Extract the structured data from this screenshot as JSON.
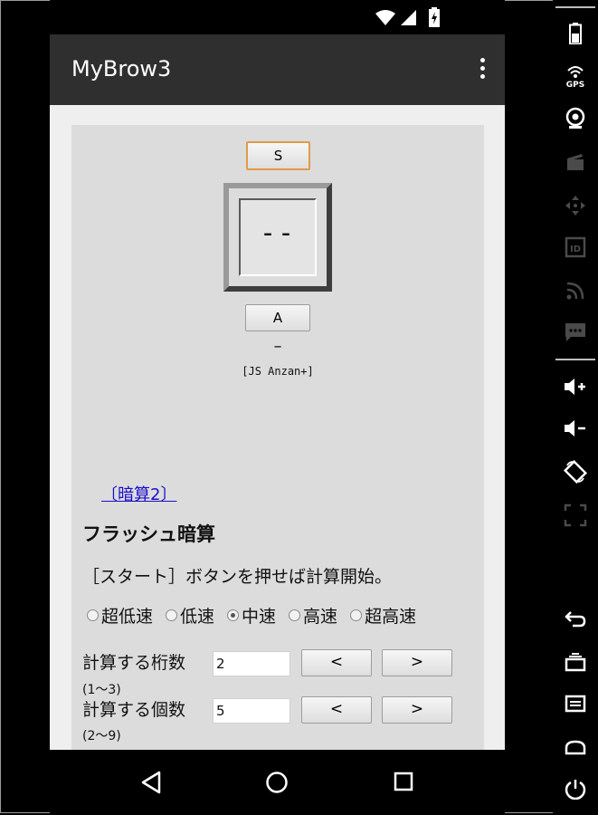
{
  "app": {
    "title": "MyBrow3"
  },
  "page": {
    "start_button": "S",
    "display_value": "--",
    "answer_button": "A",
    "dash": "–",
    "js_label": "[JS Anzan+]",
    "link_text": "〔暗算2〕",
    "heading": "フラッシュ暗算",
    "instruction": "［スタート］ボタンを押せば計算開始。",
    "speeds": [
      {
        "label": "超低速",
        "checked": false
      },
      {
        "label": "低速",
        "checked": false
      },
      {
        "label": "中速",
        "checked": true
      },
      {
        "label": "高速",
        "checked": false
      },
      {
        "label": "超高速",
        "checked": false
      }
    ],
    "digits": {
      "label": "計算する桁数",
      "range": "(1～3)",
      "value": "2",
      "dec": "<",
      "inc": ">"
    },
    "count": {
      "label": "計算する個数",
      "range": "(2～9)",
      "value": "5",
      "dec": "<",
      "inc": ">"
    }
  },
  "colors": {
    "app_bar": "#2f2f2f",
    "web_bg": "#dcdcdc",
    "link": "#1a0dcc",
    "focus_border": "#e19a4a"
  },
  "icons": {
    "status": [
      "wifi-icon",
      "signal-icon",
      "battery-charging-icon"
    ],
    "nav": [
      "back-icon",
      "home-icon",
      "recents-icon"
    ],
    "side": [
      "battery-icon",
      "gps-icon",
      "camera-icon",
      "clapperboard-icon",
      "dpad-icon",
      "id-icon",
      "rss-icon",
      "message-icon",
      "volume-up-icon",
      "volume-down-icon",
      "rotate-icon",
      "scale-icon",
      "back-icon",
      "recents-icon",
      "menu-icon",
      "home-icon",
      "power-icon"
    ]
  }
}
